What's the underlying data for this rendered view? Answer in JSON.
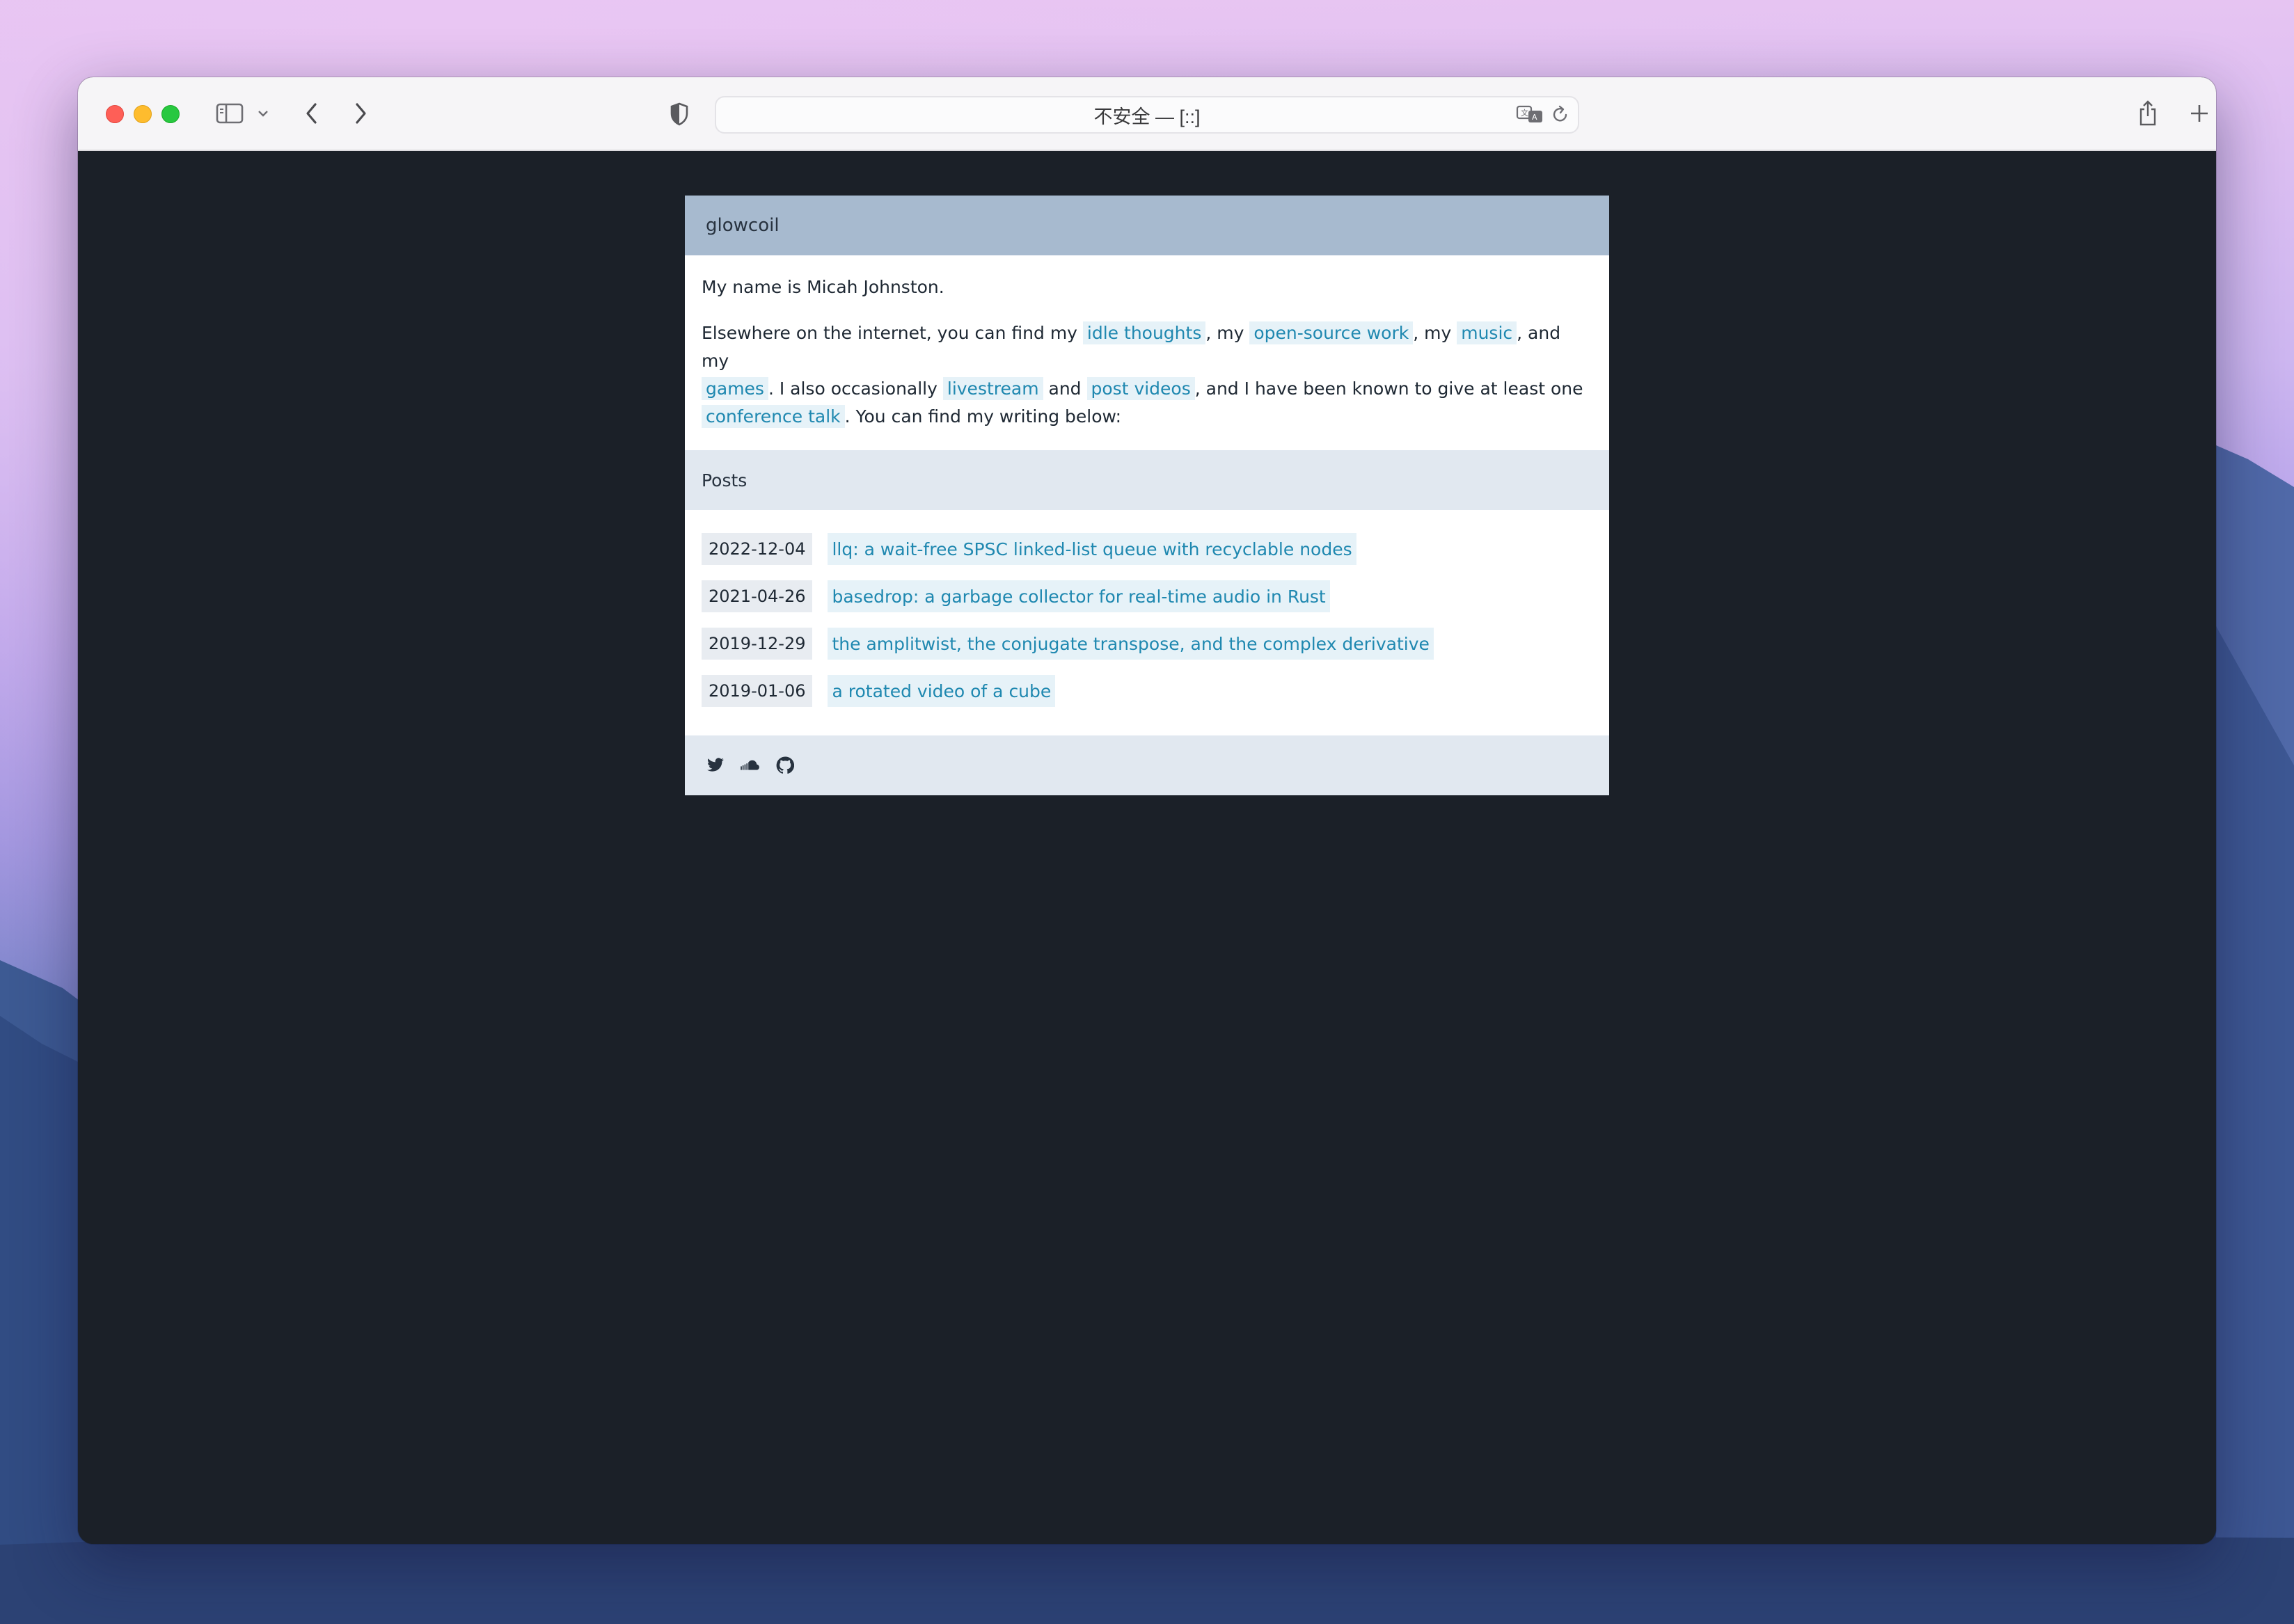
{
  "browser": {
    "address_text": "不安全 — [::]"
  },
  "site": {
    "title": "glowcoil",
    "intro_name": "My name is Micah Johnston.",
    "intro": {
      "t1": "Elsewhere on the internet, you can find my ",
      "l1": "idle thoughts",
      "t2": ", my ",
      "l2": "open-source work",
      "t3": ", my ",
      "l3": "music",
      "t4": ", and my ",
      "l4": "games",
      "t5": ". I also occasionally ",
      "l5": "livestream",
      "t6": " and ",
      "l6": "post videos",
      "t7": ", and I have been known to give at least one ",
      "l7": "conference talk",
      "t8": ". You can find my writing below:"
    },
    "posts_heading": "Posts",
    "posts": [
      {
        "date": "2022-12-04",
        "title": "llq: a wait-free SPSC linked-list queue with recyclable nodes"
      },
      {
        "date": "2021-04-26",
        "title": "basedrop: a garbage collector for real-time audio in Rust"
      },
      {
        "date": "2019-12-29",
        "title": "the amplitwist, the conjugate transpose, and the complex derivative"
      },
      {
        "date": "2019-01-06",
        "title": "a rotated video of a cube"
      }
    ],
    "footer_icons": [
      "twitter-icon",
      "soundcloud-icon",
      "github-icon"
    ]
  },
  "colors": {
    "header_bg": "#a7bacf",
    "section_bg": "#e1e8f0",
    "link_text": "#1f88b0",
    "link_bg": "#e6f2f8",
    "page_bg": "#1b2028"
  }
}
